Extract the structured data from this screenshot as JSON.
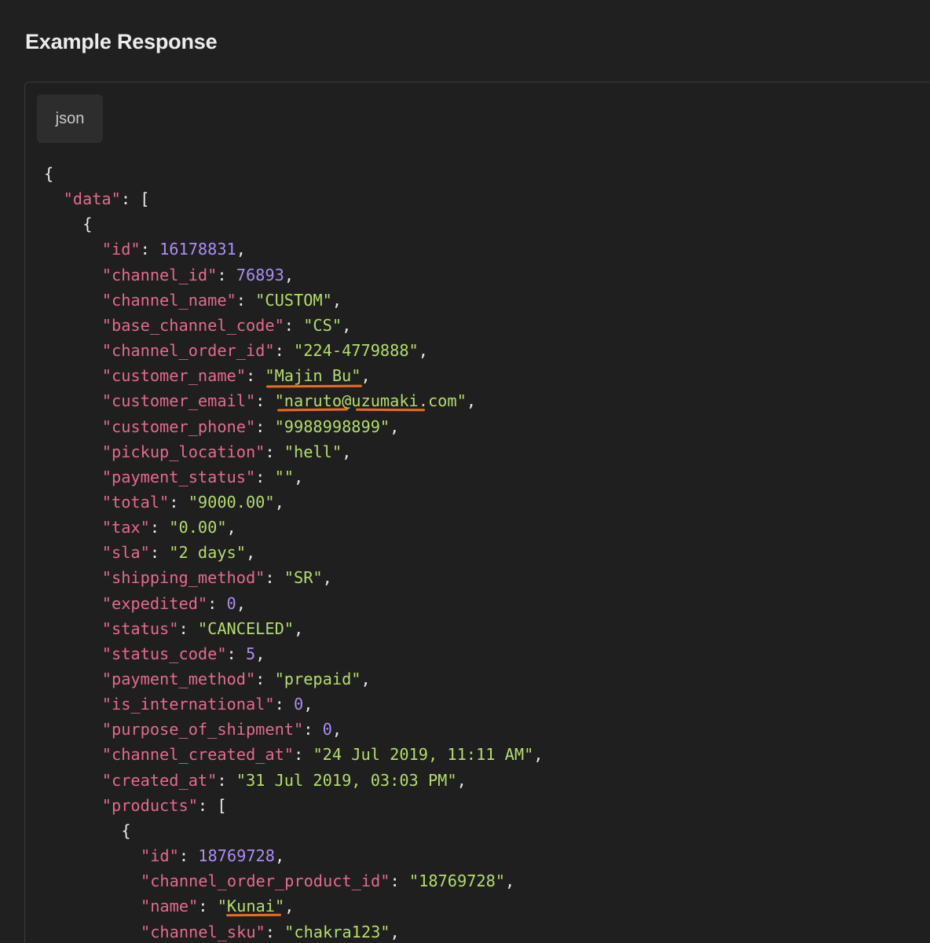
{
  "section": {
    "title": "Example Response"
  },
  "code_block": {
    "language": "json",
    "lines": [
      {
        "indent": 0,
        "tokens": [
          {
            "t": "p",
            "v": "{"
          }
        ]
      },
      {
        "indent": 1,
        "tokens": [
          {
            "t": "k",
            "v": "\"data\""
          },
          {
            "t": "p",
            "v": ": ["
          }
        ]
      },
      {
        "indent": 2,
        "tokens": [
          {
            "t": "p",
            "v": "{"
          }
        ]
      },
      {
        "indent": 3,
        "tokens": [
          {
            "t": "k",
            "v": "\"id\""
          },
          {
            "t": "p",
            "v": ": "
          },
          {
            "t": "n",
            "v": "16178831"
          },
          {
            "t": "p",
            "v": ","
          }
        ]
      },
      {
        "indent": 3,
        "tokens": [
          {
            "t": "k",
            "v": "\"channel_id\""
          },
          {
            "t": "p",
            "v": ": "
          },
          {
            "t": "n",
            "v": "76893"
          },
          {
            "t": "p",
            "v": ","
          }
        ]
      },
      {
        "indent": 3,
        "tokens": [
          {
            "t": "k",
            "v": "\"channel_name\""
          },
          {
            "t": "p",
            "v": ": "
          },
          {
            "t": "s",
            "v": "\"CUSTOM\""
          },
          {
            "t": "p",
            "v": ","
          }
        ]
      },
      {
        "indent": 3,
        "tokens": [
          {
            "t": "k",
            "v": "\"base_channel_code\""
          },
          {
            "t": "p",
            "v": ": "
          },
          {
            "t": "s",
            "v": "\"CS\""
          },
          {
            "t": "p",
            "v": ","
          }
        ]
      },
      {
        "indent": 3,
        "tokens": [
          {
            "t": "k",
            "v": "\"channel_order_id\""
          },
          {
            "t": "p",
            "v": ": "
          },
          {
            "t": "s",
            "v": "\"224-4779888\""
          },
          {
            "t": "p",
            "v": ","
          }
        ]
      },
      {
        "indent": 3,
        "tokens": [
          {
            "t": "k",
            "v": "\"customer_name\""
          },
          {
            "t": "p",
            "v": ": "
          },
          {
            "t": "s",
            "v": "\"Majin Bu\""
          },
          {
            "t": "p",
            "v": ","
          }
        ]
      },
      {
        "indent": 3,
        "tokens": [
          {
            "t": "k",
            "v": "\"customer_email\""
          },
          {
            "t": "p",
            "v": ": "
          },
          {
            "t": "s",
            "v": "\"naruto@uzumaki.com\""
          },
          {
            "t": "p",
            "v": ","
          }
        ]
      },
      {
        "indent": 3,
        "tokens": [
          {
            "t": "k",
            "v": "\"customer_phone\""
          },
          {
            "t": "p",
            "v": ": "
          },
          {
            "t": "s",
            "v": "\"9988998899\""
          },
          {
            "t": "p",
            "v": ","
          }
        ]
      },
      {
        "indent": 3,
        "tokens": [
          {
            "t": "k",
            "v": "\"pickup_location\""
          },
          {
            "t": "p",
            "v": ": "
          },
          {
            "t": "s",
            "v": "\"hell\""
          },
          {
            "t": "p",
            "v": ","
          }
        ]
      },
      {
        "indent": 3,
        "tokens": [
          {
            "t": "k",
            "v": "\"payment_status\""
          },
          {
            "t": "p",
            "v": ": "
          },
          {
            "t": "s",
            "v": "\"\""
          },
          {
            "t": "p",
            "v": ","
          }
        ]
      },
      {
        "indent": 3,
        "tokens": [
          {
            "t": "k",
            "v": "\"total\""
          },
          {
            "t": "p",
            "v": ": "
          },
          {
            "t": "s",
            "v": "\"9000.00\""
          },
          {
            "t": "p",
            "v": ","
          }
        ]
      },
      {
        "indent": 3,
        "tokens": [
          {
            "t": "k",
            "v": "\"tax\""
          },
          {
            "t": "p",
            "v": ": "
          },
          {
            "t": "s",
            "v": "\"0.00\""
          },
          {
            "t": "p",
            "v": ","
          }
        ]
      },
      {
        "indent": 3,
        "tokens": [
          {
            "t": "k",
            "v": "\"sla\""
          },
          {
            "t": "p",
            "v": ": "
          },
          {
            "t": "s",
            "v": "\"2 days\""
          },
          {
            "t": "p",
            "v": ","
          }
        ]
      },
      {
        "indent": 3,
        "tokens": [
          {
            "t": "k",
            "v": "\"shipping_method\""
          },
          {
            "t": "p",
            "v": ": "
          },
          {
            "t": "s",
            "v": "\"SR\""
          },
          {
            "t": "p",
            "v": ","
          }
        ]
      },
      {
        "indent": 3,
        "tokens": [
          {
            "t": "k",
            "v": "\"expedited\""
          },
          {
            "t": "p",
            "v": ": "
          },
          {
            "t": "n",
            "v": "0"
          },
          {
            "t": "p",
            "v": ","
          }
        ]
      },
      {
        "indent": 3,
        "tokens": [
          {
            "t": "k",
            "v": "\"status\""
          },
          {
            "t": "p",
            "v": ": "
          },
          {
            "t": "s",
            "v": "\"CANCELED\""
          },
          {
            "t": "p",
            "v": ","
          }
        ]
      },
      {
        "indent": 3,
        "tokens": [
          {
            "t": "k",
            "v": "\"status_code\""
          },
          {
            "t": "p",
            "v": ": "
          },
          {
            "t": "n",
            "v": "5"
          },
          {
            "t": "p",
            "v": ","
          }
        ]
      },
      {
        "indent": 3,
        "tokens": [
          {
            "t": "k",
            "v": "\"payment_method\""
          },
          {
            "t": "p",
            "v": ": "
          },
          {
            "t": "s",
            "v": "\"prepaid\""
          },
          {
            "t": "p",
            "v": ","
          }
        ]
      },
      {
        "indent": 3,
        "tokens": [
          {
            "t": "k",
            "v": "\"is_international\""
          },
          {
            "t": "p",
            "v": ": "
          },
          {
            "t": "n",
            "v": "0"
          },
          {
            "t": "p",
            "v": ","
          }
        ]
      },
      {
        "indent": 3,
        "tokens": [
          {
            "t": "k",
            "v": "\"purpose_of_shipment\""
          },
          {
            "t": "p",
            "v": ": "
          },
          {
            "t": "n",
            "v": "0"
          },
          {
            "t": "p",
            "v": ","
          }
        ]
      },
      {
        "indent": 3,
        "tokens": [
          {
            "t": "k",
            "v": "\"channel_created_at\""
          },
          {
            "t": "p",
            "v": ": "
          },
          {
            "t": "s",
            "v": "\"24 Jul 2019, 11:11 AM\""
          },
          {
            "t": "p",
            "v": ","
          }
        ]
      },
      {
        "indent": 3,
        "tokens": [
          {
            "t": "k",
            "v": "\"created_at\""
          },
          {
            "t": "p",
            "v": ": "
          },
          {
            "t": "s",
            "v": "\"31 Jul 2019, 03:03 PM\""
          },
          {
            "t": "p",
            "v": ","
          }
        ]
      },
      {
        "indent": 3,
        "tokens": [
          {
            "t": "k",
            "v": "\"products\""
          },
          {
            "t": "p",
            "v": ": ["
          }
        ]
      },
      {
        "indent": 4,
        "tokens": [
          {
            "t": "p",
            "v": "{"
          }
        ]
      },
      {
        "indent": 5,
        "tokens": [
          {
            "t": "k",
            "v": "\"id\""
          },
          {
            "t": "p",
            "v": ": "
          },
          {
            "t": "n",
            "v": "18769728"
          },
          {
            "t": "p",
            "v": ","
          }
        ]
      },
      {
        "indent": 5,
        "tokens": [
          {
            "t": "k",
            "v": "\"channel_order_product_id\""
          },
          {
            "t": "p",
            "v": ": "
          },
          {
            "t": "s",
            "v": "\"18769728\""
          },
          {
            "t": "p",
            "v": ","
          }
        ]
      },
      {
        "indent": 5,
        "tokens": [
          {
            "t": "k",
            "v": "\"name\""
          },
          {
            "t": "p",
            "v": ": "
          },
          {
            "t": "s",
            "v": "\"Kunai\""
          },
          {
            "t": "p",
            "v": ","
          }
        ]
      },
      {
        "indent": 5,
        "tokens": [
          {
            "t": "k",
            "v": "\"channel_sku\""
          },
          {
            "t": "p",
            "v": ": "
          },
          {
            "t": "s",
            "v": "\"chakra123\""
          },
          {
            "t": "p",
            "v": ","
          }
        ]
      }
    ]
  },
  "annotation_color": "#ef6a1c"
}
